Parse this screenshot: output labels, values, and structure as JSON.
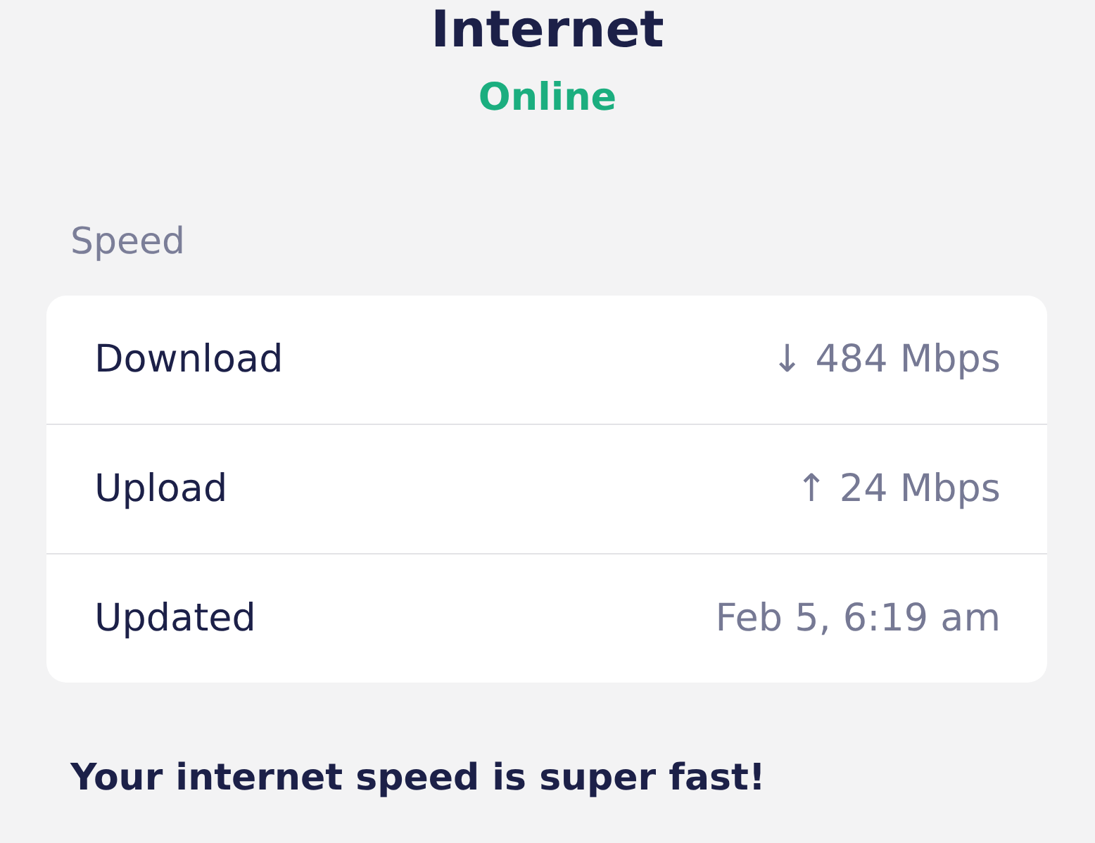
{
  "header": {
    "title": "Internet",
    "status": "Online"
  },
  "speed": {
    "heading": "Speed",
    "rows": [
      {
        "label": "Download",
        "value": "↓ 484 Mbps"
      },
      {
        "label": "Upload",
        "value": "↑ 24 Mbps"
      },
      {
        "label": "Updated",
        "value": "Feb 5, 6:19 am"
      }
    ]
  },
  "summary": {
    "heading": "Your internet speed is super fast!"
  }
}
